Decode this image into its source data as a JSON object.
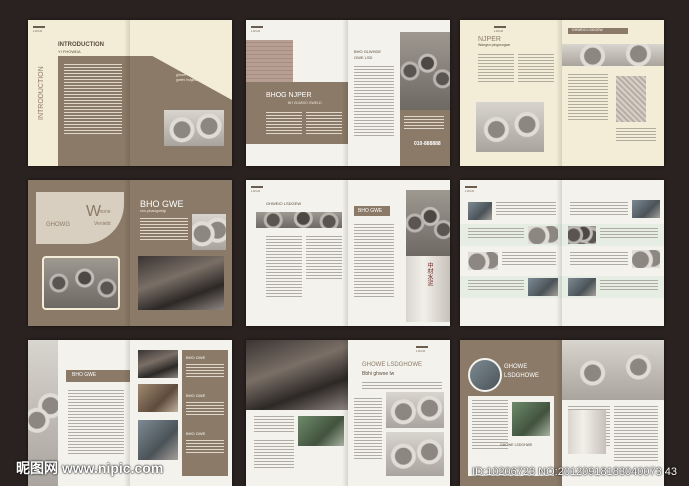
{
  "row1": {
    "s1": {
      "title": "INTRODUCTION",
      "subtitle": "YI FHOWDA",
      "vertical": "INTRODUCTION",
      "brown_lines": [
        "ghowe rnophwnwe",
        "gwehi hslghwe sdghwe"
      ]
    },
    "s2": {
      "title": "BHOG NJPER",
      "subtitle": "BH GLWDIO GWELD",
      "right_head": "BHO GLWHDE",
      "right_sub": "GWE LSD",
      "phone": "010-888888"
    },
    "s3": {
      "title": "NJPER",
      "subtitle": "Wangsn pingsrwgwe",
      "right_head": "GHWEIO LSDGEW"
    }
  },
  "row2": {
    "s1": {
      "big": "W",
      "line1": "mone",
      "line2": "GHOWG",
      "line3": "Veniebt",
      "title": "BHO GWE",
      "subtitle": "sho-pioauigwelgi"
    },
    "s2": {
      "left_head": "GHWEIO LSDGEW",
      "right_head": "BHO GWE",
      "tower_text": "中材水泥"
    },
    "s3": {}
  },
  "row3": {
    "s1": {
      "left_title": "BHO GWE",
      "right_heads": [
        "BHO GWE",
        "BHO GWE",
        "BHO GWE"
      ]
    },
    "s2": {
      "title": "GHOWE LSDGHOWE",
      "subtitle": "Bbhi ghwoe lw"
    },
    "s3": {
      "title_line1": "GHOWE",
      "title_line2": "LSDGHOWE",
      "caption": "GHOWE LSDGHWE"
    }
  },
  "watermark": {
    "left": "昵图网 www.nipic.com",
    "right": "ID:10206723 NO:20120918183040073 43"
  }
}
